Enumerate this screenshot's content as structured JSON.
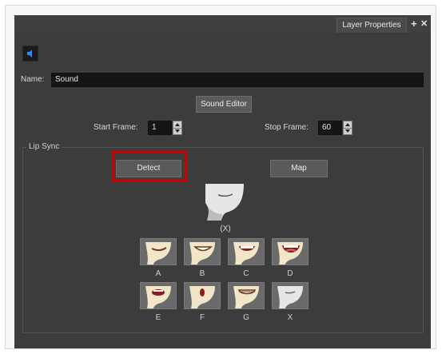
{
  "panel": {
    "tab_title": "Layer Properties",
    "tab_add_symbol": "+",
    "tab_close_symbol": "✕",
    "name_label": "Name:",
    "name_value": "Sound",
    "sound_editor_label": "Sound Editor",
    "start_frame_label": "Start Frame:",
    "start_frame_value": "1",
    "stop_frame_label": "Stop Frame:",
    "stop_frame_value": "60",
    "lip_sync_title": "Lip Sync",
    "detect_label": "Detect",
    "map_label": "Map",
    "current_mouth_label": "(X)",
    "mouths": [
      {
        "label": "A",
        "icon": "mouth-a-icon"
      },
      {
        "label": "B",
        "icon": "mouth-b-icon"
      },
      {
        "label": "C",
        "icon": "mouth-c-icon"
      },
      {
        "label": "D",
        "icon": "mouth-d-icon"
      },
      {
        "label": "E",
        "icon": "mouth-e-icon"
      },
      {
        "label": "F",
        "icon": "mouth-f-icon"
      },
      {
        "label": "G",
        "icon": "mouth-g-icon"
      },
      {
        "label": "X",
        "icon": "mouth-x-icon"
      }
    ]
  },
  "colors": {
    "panel_bg": "#3c3c3c",
    "highlight": "#d10000",
    "skin": "#f3e6c8",
    "sound_icon": "#1e90ff"
  }
}
